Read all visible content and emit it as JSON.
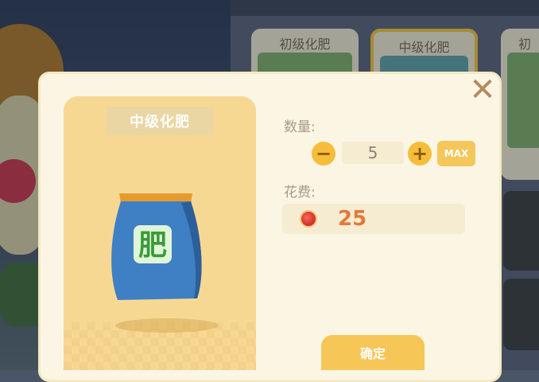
{
  "shop": {
    "cards": [
      {
        "title": "初级化肥",
        "img_color": "#7fb06a"
      },
      {
        "title": "中级化肥",
        "img_color": "#5fa2a8"
      },
      {
        "title": "初",
        "img_color": "#7fb06a"
      }
    ]
  },
  "dialog": {
    "item_name": "中级化肥",
    "bag_label": "肥",
    "quantity_label": "数量:",
    "quantity_value": "5",
    "minus_symbol": "−",
    "plus_symbol": "+",
    "max_label": "MAX",
    "cost_label": "花费:",
    "cost_value": "25",
    "confirm_label": "确定",
    "close_symbol": "✕"
  },
  "colors": {
    "accent": "#f5bd3a",
    "cost": "#e07a3a",
    "bag_blue": "#3f7fc4",
    "bag_label_green": "#3a9a3a"
  }
}
